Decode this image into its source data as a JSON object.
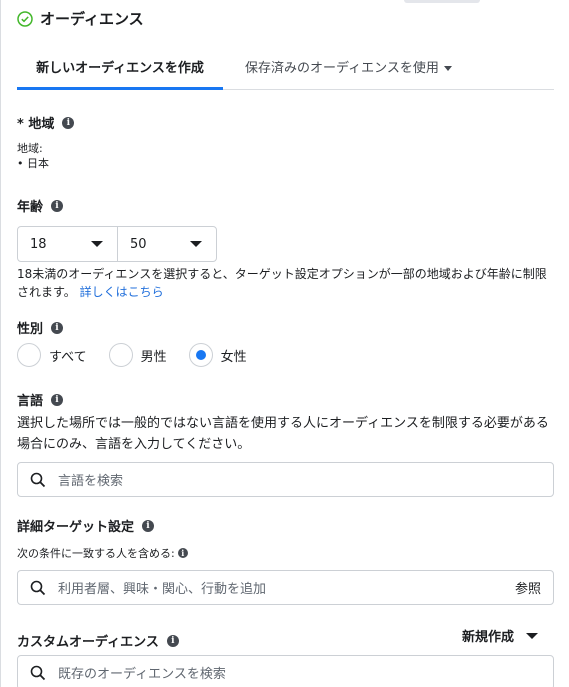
{
  "header": {
    "title": "オーディエンス",
    "icon": "check-circle-icon",
    "accent": "#42b72a"
  },
  "tabs": [
    {
      "label": "新しいオーディエンスを作成"
    },
    {
      "label": "保存済みのオーディエンスを使用"
    }
  ],
  "region": {
    "title": "* 地域",
    "sublabel": "地域:",
    "items": [
      "日本"
    ]
  },
  "age": {
    "title": "年齢",
    "min": "18",
    "max": "50",
    "note": "18未満のオーディエンスを選択すると、ターゲット設定オプションが一部の地域および年齢に制限されます。",
    "link": "詳しくはこちら"
  },
  "gender": {
    "title": "性別",
    "options": [
      "すべて",
      "男性",
      "女性"
    ],
    "selected": "女性"
  },
  "language": {
    "title": "言語",
    "description": "選択した場所では一般的ではない言語を使用する人にオーディエンスを制限する必要がある場合にのみ、言語を入力してください。",
    "placeholder": "言語を検索"
  },
  "detailed": {
    "title": "詳細ターゲット設定",
    "include_label": "次の条件に一致する人を含める:",
    "placeholder": "利用者層、興味・関心、行動を追加",
    "browse": "参照"
  },
  "custom": {
    "title": "カスタムオーディエンス",
    "new_label": "新規作成",
    "placeholder": "既存のオーディエンスを検索"
  },
  "colors": {
    "accent": "#1877f2",
    "link": "#216fdb",
    "border": "#ccd0d5"
  }
}
